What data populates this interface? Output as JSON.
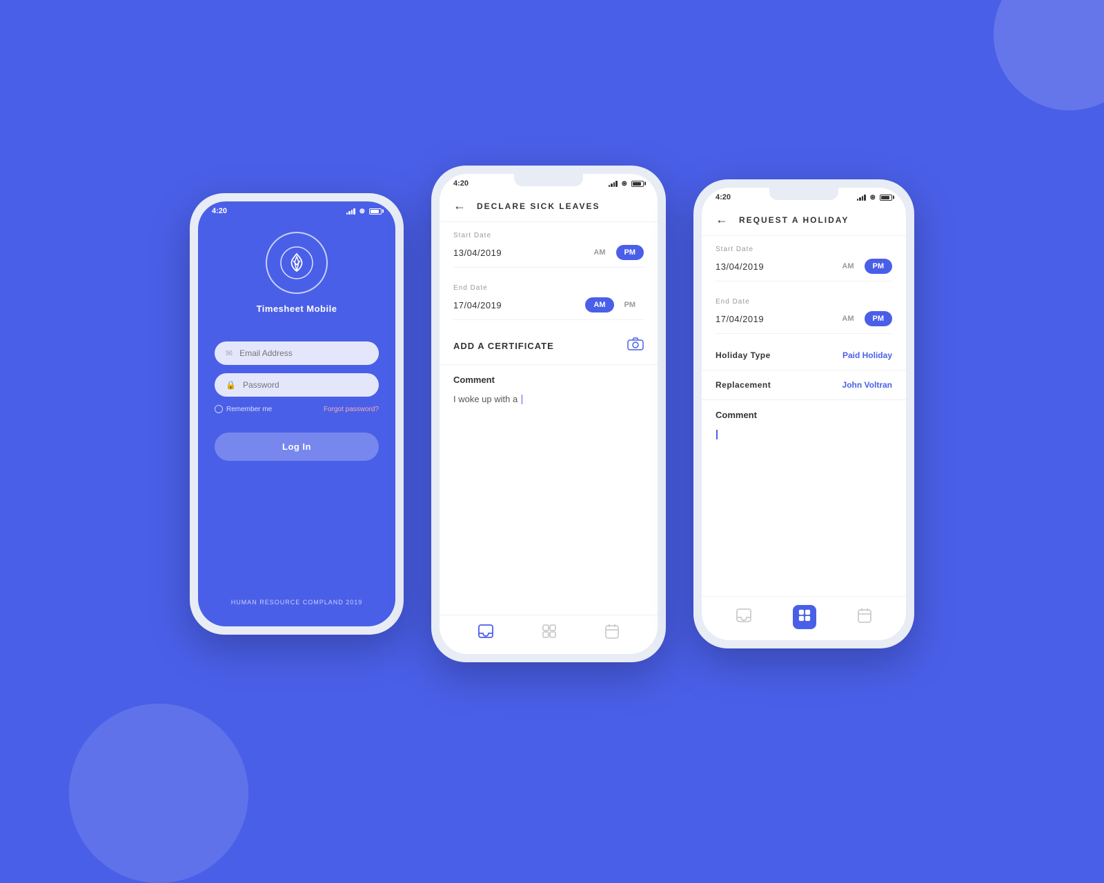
{
  "background": "#4A5FE8",
  "phone1": {
    "time": "4:20",
    "logo_alt": "Timesheet Mobile Logo",
    "app_title": "Timesheet Mobile",
    "email_placeholder": "Email Address",
    "password_placeholder": "Password",
    "remember_me": "Remember me",
    "forgot_password": "Forgot password?",
    "login_button": "Log In",
    "footer": "HUMAN RESOURCE COMPLAND 2019"
  },
  "phone2": {
    "time": "4:20",
    "title": "DECLARE SICK LEAVES",
    "start_date_label": "Start Date",
    "start_date": "13/04/2019",
    "start_am": "AM",
    "start_pm": "PM",
    "start_active": "pm",
    "end_date_label": "End Date",
    "end_date": "17/04/2019",
    "end_am": "AM",
    "end_pm": "PM",
    "end_active": "am",
    "certificate_label": "ADD A CERTIFICATE",
    "comment_title": "Comment",
    "comment_text": "I woke up with a",
    "nav_icons": [
      "inbox",
      "grid",
      "calendar"
    ]
  },
  "phone3": {
    "time": "4:20",
    "title": "REQUEST A HOLIDAY",
    "start_date_label": "Start Date",
    "start_date": "13/04/2019",
    "start_am": "AM",
    "start_pm": "PM",
    "start_active": "pm",
    "end_date_label": "End Date",
    "end_date": "17/04/2019",
    "end_am": "AM",
    "end_pm": "PM",
    "end_active": "pm",
    "holiday_type_label": "Holiday Type",
    "holiday_type_value": "Paid Holiday",
    "replacement_label": "Replacement",
    "replacement_value": "John Voltran",
    "comment_title": "Comment",
    "nav_icons": [
      "inbox",
      "grid",
      "calendar"
    ]
  }
}
